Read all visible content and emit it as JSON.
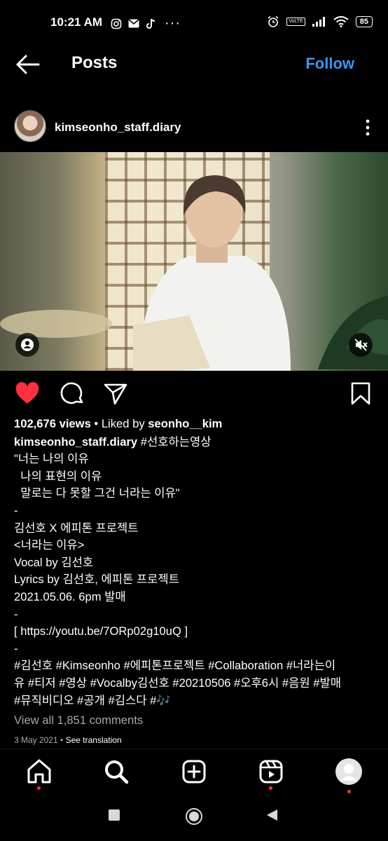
{
  "status": {
    "time": "10:21 AM",
    "dots": "···",
    "battery": "85",
    "volte": "VoLTE"
  },
  "topbar": {
    "title": "Posts",
    "follow_label": "Follow"
  },
  "post": {
    "username": "kimseonho_staff.diary",
    "views_count": "102,676 views",
    "liked_by_prefix": " • Liked by ",
    "liked_by_user": "seonho__kim",
    "caption_user": "kimseonho_staff.diary",
    "caption_lines": [
      " #선호하는영상",
      "\"너는 나의 이유",
      "  나의 표현의 이유",
      "  말로는 다 못할 그건 너라는 이유\"",
      "-",
      "김선호 X 에피톤 프로젝트",
      "<너라는 이유>",
      "Vocal by 김선호",
      "Lyrics by 김선호, 에피톤 프로젝트",
      "2021.05.06. 6pm 발매",
      "-",
      "[ https://youtu.be/7ORp02g10uQ ]",
      "-",
      "#김선호 #Kimseonho #에피톤프로젝트 #Collaboration #너라는이",
      "유 #티저 #영상 #Vocalby김선호 #20210506 #오후6시 #음원 #발매",
      "#뮤직비디오 #공개 #김스다 #🎶"
    ],
    "view_all_comments": "View all 1,851 comments",
    "date": "3 May 2021",
    "see_translation": "See translation"
  },
  "colors": {
    "accent": "#3797f0",
    "like": "#ff3040",
    "muted": "#a8a8a8"
  },
  "icons": [
    "back-arrow-icon",
    "more-vertical-icon",
    "person-tag-icon",
    "mute-icon",
    "heart-icon",
    "comment-icon",
    "share-icon",
    "bookmark-icon",
    "home-icon",
    "search-icon",
    "add-icon",
    "reels-icon",
    "profile-icon"
  ]
}
